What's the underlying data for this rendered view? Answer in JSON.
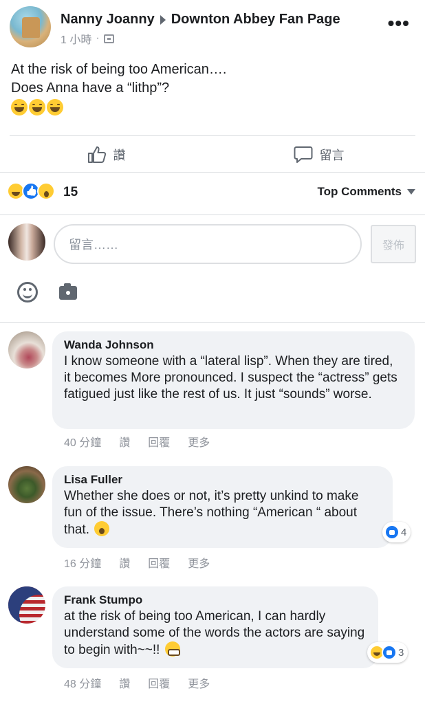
{
  "post": {
    "author": "Nanny Joanny",
    "group": "Downton Abbey Fan Page",
    "time": "1 小時",
    "separator": "·",
    "text_line1": "At the risk of being too American….",
    "text_line2": "Does Anna have a “lithp”?",
    "emojis": [
      "laughing-tears",
      "laughing-tears",
      "laughing-tears"
    ],
    "more": "•••"
  },
  "actions": {
    "like_label": "讚",
    "comment_label": "留言"
  },
  "reactions": {
    "icons": [
      "haha",
      "like",
      "wow"
    ],
    "count": "15",
    "sort_label": "Top Comments"
  },
  "composer": {
    "placeholder": "留言……",
    "post_label": "發佈"
  },
  "comments": [
    {
      "name": "Wanda Johnson",
      "text": "I know someone with a “lateral lisp”. When they are tired, it becomes More pronounced. I suspect the “actress” gets fatigued just like the rest of us. It just “sounds” worse.",
      "time": "40 分鐘",
      "like": "讚",
      "reply": "回覆",
      "more": "更多"
    },
    {
      "name": "Lisa Fuller",
      "text": "Whether she does or not, it’s pretty unkind to make fun of the issue. There’s nothing “American “ about that.",
      "time": "16 分鐘",
      "like": "讚",
      "reply": "回覆",
      "more": "更多",
      "reaction_count": "4"
    },
    {
      "name": "Frank Stumpo",
      "text": "at the risk of being too American, I can hardly understand some of the words the actors are saying to begin with~~!!",
      "time": "48 分鐘",
      "like": "讚",
      "reply": "回覆",
      "more": "更多",
      "reaction_count": "3"
    }
  ],
  "colors": {
    "text": "#1c1e21",
    "secondary": "#90949c",
    "bubble": "#f0f2f5",
    "like_blue": "#1877f2",
    "emoji_yellow": "#ffcc33"
  }
}
